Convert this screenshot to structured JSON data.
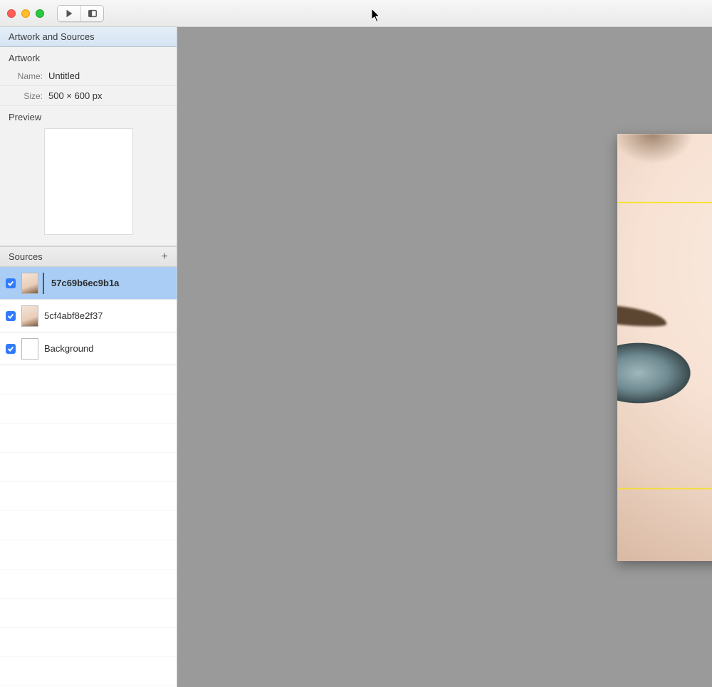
{
  "panel": {
    "title": "Artwork and Sources",
    "artwork_heading": "Artwork",
    "name_label": "Name:",
    "name_value": "Untitled",
    "size_label": "Size:",
    "size_value": "500 × 600 px",
    "preview_label": "Preview"
  },
  "sources": {
    "heading": "Sources",
    "add_glyph": "+",
    "items": [
      {
        "name": "57c69b6ec9b1a",
        "checked": true,
        "selected": true,
        "thumb": "face"
      },
      {
        "name": "5cf4abf8e2f37",
        "checked": true,
        "selected": false,
        "thumb": "face"
      },
      {
        "name": "Background",
        "checked": true,
        "selected": false,
        "thumb": "bg"
      }
    ]
  },
  "toolbar": {
    "play_icon": "play",
    "panel_icon": "panel"
  },
  "canvas": {
    "artboard_w": 500,
    "artboard_h": 600
  }
}
